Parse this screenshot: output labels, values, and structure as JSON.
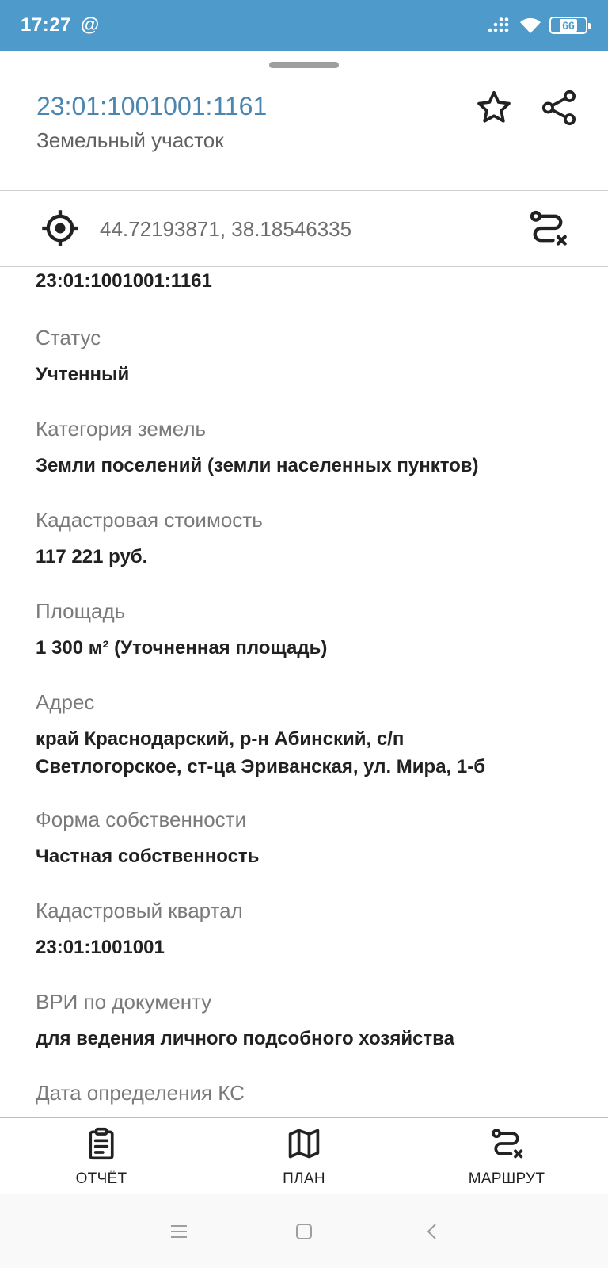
{
  "status_bar": {
    "time": "17:27",
    "at_sign": "@",
    "battery": "66"
  },
  "header": {
    "cadastral_number": "23:01:1001001:1161",
    "object_type": "Земельный участок"
  },
  "location": {
    "coordinates": "44.72193871, 38.18546335"
  },
  "details": {
    "cadastral_number_value": "23:01:1001001:1161",
    "status_label": "Статус",
    "status_value": "Учтенный",
    "category_label": "Категория земель",
    "category_value": "Земли поселений (земли населенных пунктов)",
    "value_label": "Кадастровая стоимость",
    "value_value": "117 221 руб.",
    "area_label": "Площадь",
    "area_value": "1 300 м² (Уточненная площадь)",
    "address_label": "Адрес",
    "address_line1": "край Краснодарский, р-н Абинский, с/п",
    "address_line2": "Светлогорское, ст-ца Эриванская, ул. Мира, 1-б",
    "ownership_label": "Форма собственности",
    "ownership_value": "Частная собственность",
    "quarter_label": "Кадастровый квартал",
    "quarter_value": "23:01:1001001",
    "usage_label": "ВРИ по документу",
    "usage_value": "для ведения личного подсобного хозяйства",
    "date_label": "Дата определения КС"
  },
  "bottom_actions": {
    "report": "ОТЧЁТ",
    "plan": "ПЛАН",
    "route": "МАРШРУТ"
  },
  "colors": {
    "status_bar": "#4e9bcb",
    "title": "#4a86b0"
  }
}
